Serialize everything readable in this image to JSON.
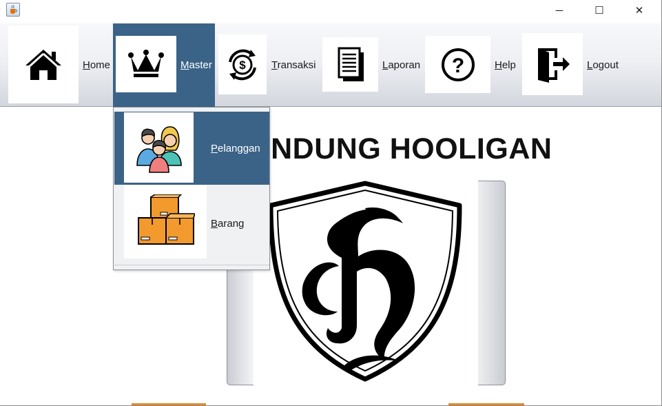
{
  "window": {
    "app_icon": "java-cup-icon",
    "controls": {
      "minimize": "─",
      "maximize": "☐",
      "close": "✕"
    }
  },
  "menubar": {
    "items": [
      {
        "label": "Home",
        "icon": "house-icon"
      },
      {
        "label": "Master",
        "icon": "crown-icon",
        "active": true
      },
      {
        "label": "Transaksi",
        "icon": "money-exchange-icon"
      },
      {
        "label": "Laporan",
        "icon": "documents-icon"
      },
      {
        "label": "Help",
        "icon": "question-icon"
      },
      {
        "label": "Logout",
        "icon": "logout-door-icon"
      }
    ],
    "active_color": "#3b6387"
  },
  "dropdown": {
    "items": [
      {
        "label": "Pelanggan",
        "icon": "people-group-icon",
        "active": true
      },
      {
        "label": "Barang",
        "icon": "boxes-icon"
      }
    ]
  },
  "content": {
    "heading": "BANDUNG HOOLIGAN",
    "logo": "shield-letter-h-logo"
  }
}
